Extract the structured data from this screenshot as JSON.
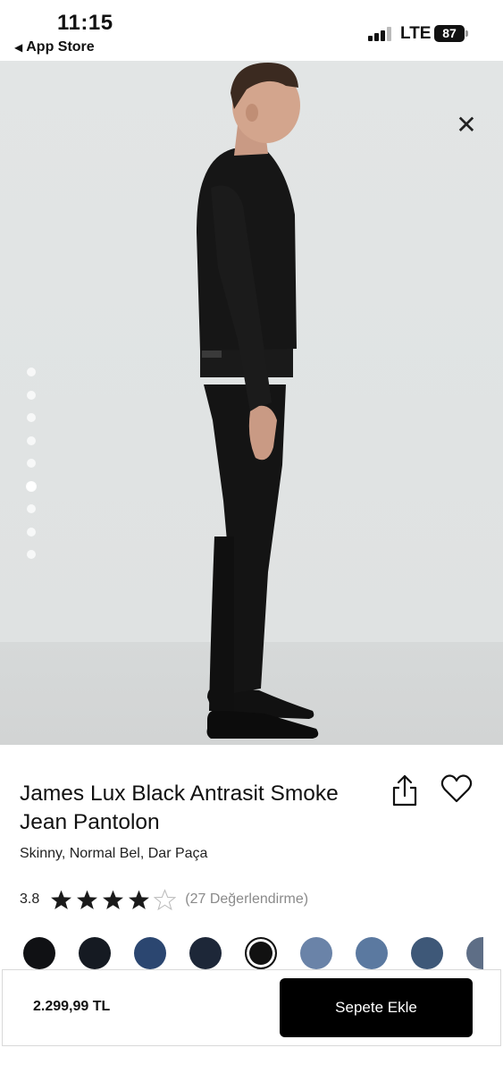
{
  "status_bar": {
    "time": "11:15",
    "back_label": "App Store",
    "network": "LTE",
    "battery": "87"
  },
  "product": {
    "title": "James Lux Black Antrasit Smoke Jean Pantolon",
    "subtitle": "Skinny, Normal Bel, Dar Paça",
    "rating": "3.8",
    "rating_stars": 4,
    "rating_max": 5,
    "review_count": "(27 Değerlendirme)",
    "image_count": 9,
    "active_image_index": 5
  },
  "color_options": [
    {
      "color": "#101114"
    },
    {
      "color": "#151a22"
    },
    {
      "color": "#2b4670"
    },
    {
      "color": "#1d2738"
    },
    {
      "color": "#111111",
      "selected": true
    },
    {
      "color": "#6a83a8"
    },
    {
      "color": "#5b79a0"
    },
    {
      "color": "#3e5878"
    },
    {
      "color": "#5e6e86"
    }
  ],
  "bottom_bar": {
    "price": "2.299,99 TL",
    "cart_button": "Sepete Ekle"
  },
  "icons": {
    "close": "close-icon",
    "share": "share-icon",
    "favorite": "heart-icon",
    "back": "back-triangle-icon"
  }
}
